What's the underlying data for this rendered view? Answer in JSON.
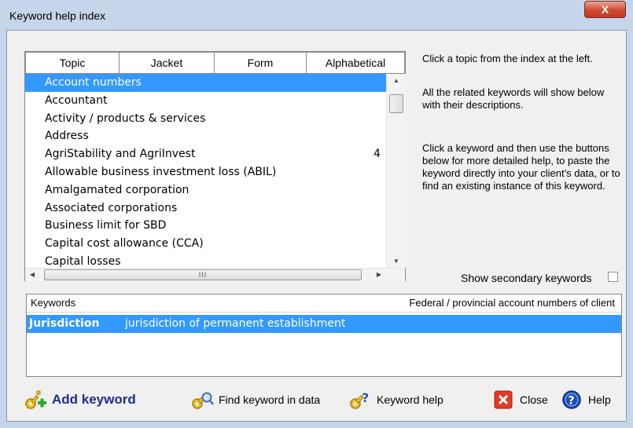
{
  "window": {
    "title": "Keyword help index",
    "close_glyph": "X"
  },
  "tabs": [
    "Topic",
    "Jacket",
    "Form",
    "Alphabetical"
  ],
  "topics": [
    {
      "label": "Account numbers",
      "selected": true,
      "count": ""
    },
    {
      "label": "Accountant",
      "selected": false,
      "count": ""
    },
    {
      "label": "Activity / products & services",
      "selected": false,
      "count": ""
    },
    {
      "label": "Address",
      "selected": false,
      "count": ""
    },
    {
      "label": "AgriStability and AgriInvest",
      "selected": false,
      "count": "4"
    },
    {
      "label": "Allowable business investment loss (ABIL)",
      "selected": false,
      "count": ""
    },
    {
      "label": "Amalgamated corporation",
      "selected": false,
      "count": ""
    },
    {
      "label": "Associated corporations",
      "selected": false,
      "count": ""
    },
    {
      "label": "Business limit for SBD",
      "selected": false,
      "count": ""
    },
    {
      "label": "Capital cost allowance (CCA)",
      "selected": false,
      "count": ""
    },
    {
      "label": "Capital losses",
      "selected": false,
      "count": ""
    }
  ],
  "scrollbar": {
    "grip": "III",
    "up_icon": "scroll-up-icon",
    "down_icon": "scroll-down-icon",
    "left_icon": "scroll-left-icon",
    "right_icon": "scroll-right-icon"
  },
  "instructions": {
    "line1": "Click a topic from the index at the left.",
    "line2": "All the related keywords will show below with their descriptions.",
    "line3": "Click a keyword and then use the buttons below for more detailed help, to paste the keyword directly into your client's data, or to find an existing instance of this keyword."
  },
  "secondary_keywords": {
    "label": "Show secondary keywords",
    "checked": false
  },
  "keywords_panel": {
    "header_left": "Keywords",
    "header_right": "Federal / provincial account numbers of client",
    "rows": [
      {
        "keyword": "Jurisdiction",
        "description": "jurisdiction of permanent establishment"
      }
    ]
  },
  "buttons": {
    "add": "Add keyword",
    "find": "Find keyword in data",
    "help_kw": "Keyword help",
    "close": "Close",
    "help": "Help"
  },
  "colors": {
    "selection": "#3399ff",
    "close_red": "#e23b24",
    "help_blue": "#1c4fb8",
    "add_text": "#1f2e8a"
  }
}
